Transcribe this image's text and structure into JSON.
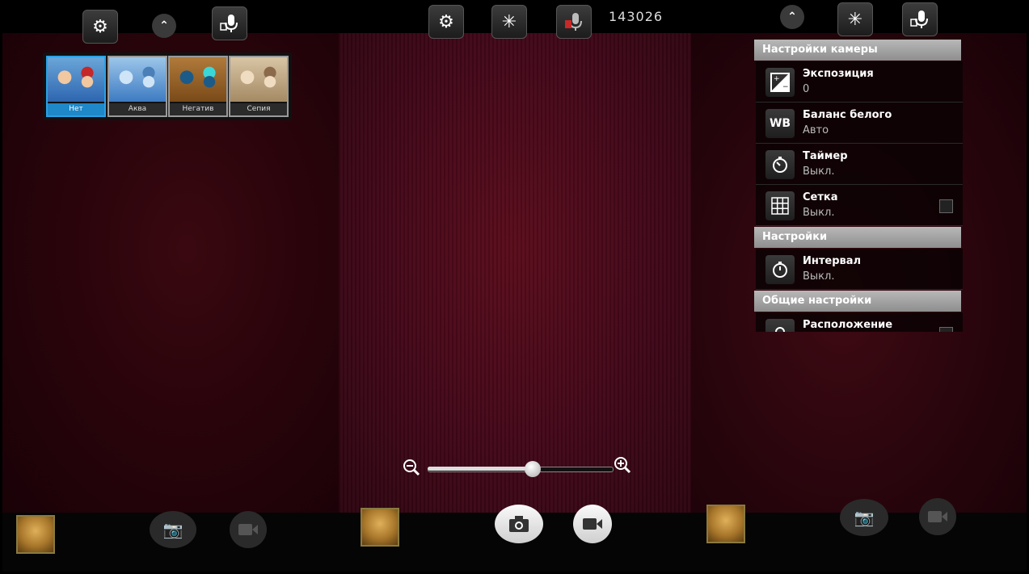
{
  "top": {
    "counter": "143026"
  },
  "filters": [
    {
      "label": "Нет",
      "selected": true
    },
    {
      "label": "Аква",
      "selected": false
    },
    {
      "label": "Негатив",
      "selected": false
    },
    {
      "label": "Сепия",
      "selected": false
    }
  ],
  "settings": {
    "camera_header": "Настройки камеры",
    "items": [
      {
        "title": "Экспозиция",
        "value": "0",
        "icon": "exposure-icon"
      },
      {
        "title": "Баланс белого",
        "value": "Авто",
        "icon": "white-balance-icon"
      },
      {
        "title": "Таймер",
        "value": "Выкл.",
        "icon": "timer-icon"
      },
      {
        "title": "Сетка",
        "value": "Выкл.",
        "icon": "grid-icon"
      }
    ],
    "settings_header": "Настройки",
    "interval": {
      "title": "Интервал",
      "value": "Выкл."
    },
    "general_header": "Общие настройки",
    "location": {
      "title": "Расположение"
    }
  },
  "zoom": {
    "level": 0.57
  },
  "colors": {
    "accent": "#2aa0e6",
    "background": "#44081a"
  }
}
